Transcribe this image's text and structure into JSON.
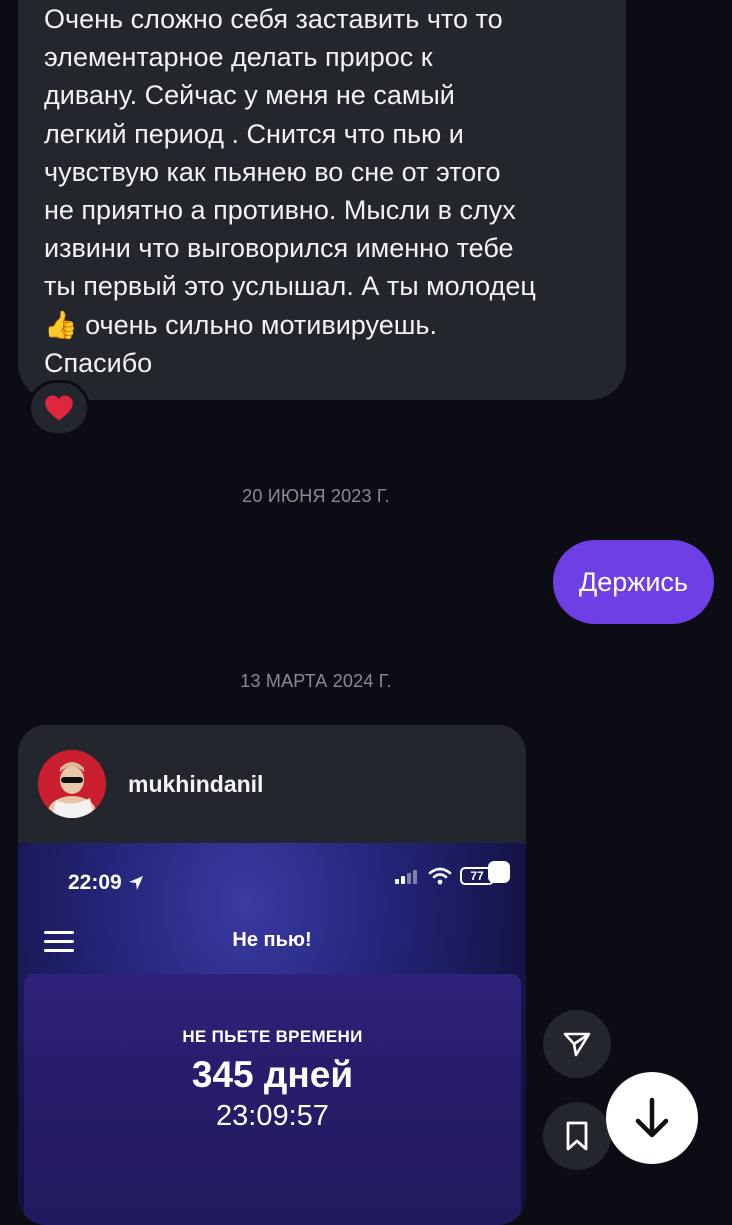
{
  "messages": {
    "incoming_text": "Очень сложно себя заставить что то\nэлементарное делать прирос к\nдивану. Сейчас у меня не самый\nлегкий период . Снится что пью и\nчувствую как пьянею во сне от этого\nне приятно а противно. Мысли в слух\nизвини что выговорился именно тебе\nты первый это услышал. А ты молодец\n👍 очень сильно мотивируешь.\nСпасибо",
    "reaction_icon": "heart-icon",
    "date_1": "20 ИЮНЯ 2023 Г.",
    "outgoing_text": "Держись",
    "date_2": "13 МАРТА 2024 Г."
  },
  "shared_post": {
    "username": "mukhindanil",
    "preview": {
      "status_time": "22:09",
      "battery": "77",
      "app_title": "Не пью!",
      "label": "НЕ ПЬЕТЕ ВРЕМЕНИ",
      "days": "345 дней",
      "timer": "23:09:57"
    }
  },
  "actions": {
    "share_icon": "send-icon",
    "save_icon": "bookmark-icon",
    "scroll_icon": "arrow-down-icon"
  },
  "colors": {
    "background": "#0b0c14",
    "bubble_incoming": "#24262d",
    "bubble_outgoing": "#6f3fe6",
    "reaction_heart": "#e0263c"
  }
}
